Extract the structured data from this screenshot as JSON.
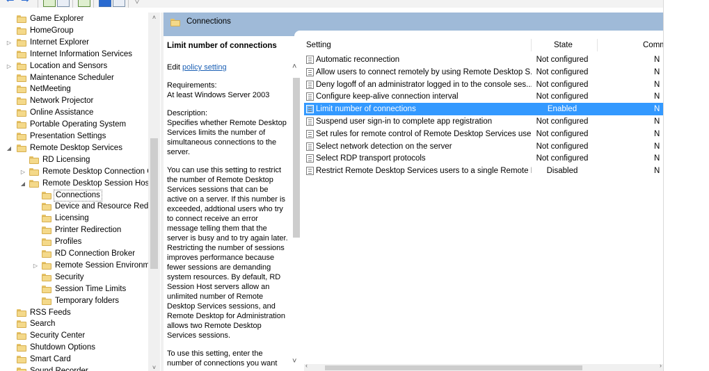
{
  "header": {
    "folder_title": "Connections"
  },
  "tree": {
    "items": [
      {
        "label": "Game Explorer",
        "level": 0,
        "expander": ""
      },
      {
        "label": "HomeGroup",
        "level": 0,
        "expander": ""
      },
      {
        "label": "Internet Explorer",
        "level": 0,
        "expander": "collapsed"
      },
      {
        "label": "Internet Information Services",
        "level": 0,
        "expander": ""
      },
      {
        "label": "Location and Sensors",
        "level": 0,
        "expander": "collapsed"
      },
      {
        "label": "Maintenance Scheduler",
        "level": 0,
        "expander": ""
      },
      {
        "label": "NetMeeting",
        "level": 0,
        "expander": ""
      },
      {
        "label": "Network Projector",
        "level": 0,
        "expander": ""
      },
      {
        "label": "Online Assistance",
        "level": 0,
        "expander": ""
      },
      {
        "label": "Portable Operating System",
        "level": 0,
        "expander": ""
      },
      {
        "label": "Presentation Settings",
        "level": 0,
        "expander": ""
      },
      {
        "label": "Remote Desktop Services",
        "level": 0,
        "expander": "expanded"
      },
      {
        "label": "RD Licensing",
        "level": 1,
        "expander": ""
      },
      {
        "label": "Remote Desktop Connection C",
        "level": 1,
        "expander": "collapsed"
      },
      {
        "label": "Remote Desktop Session Host",
        "level": 1,
        "expander": "expanded"
      },
      {
        "label": "Connections",
        "level": 2,
        "expander": "",
        "selected": true
      },
      {
        "label": "Device and Resource Redire",
        "level": 2,
        "expander": ""
      },
      {
        "label": "Licensing",
        "level": 2,
        "expander": ""
      },
      {
        "label": "Printer Redirection",
        "level": 2,
        "expander": ""
      },
      {
        "label": "Profiles",
        "level": 2,
        "expander": ""
      },
      {
        "label": "RD Connection Broker",
        "level": 2,
        "expander": ""
      },
      {
        "label": "Remote Session Environme",
        "level": 2,
        "expander": "collapsed"
      },
      {
        "label": "Security",
        "level": 2,
        "expander": ""
      },
      {
        "label": "Session Time Limits",
        "level": 2,
        "expander": ""
      },
      {
        "label": "Temporary folders",
        "level": 2,
        "expander": ""
      },
      {
        "label": "RSS Feeds",
        "level": 0,
        "expander": ""
      },
      {
        "label": "Search",
        "level": 0,
        "expander": ""
      },
      {
        "label": "Security Center",
        "level": 0,
        "expander": ""
      },
      {
        "label": "Shutdown Options",
        "level": 0,
        "expander": ""
      },
      {
        "label": "Smart Card",
        "level": 0,
        "expander": ""
      },
      {
        "label": "Sound Recorder",
        "level": 0,
        "expander": ""
      }
    ]
  },
  "description": {
    "title": "Limit number of connections",
    "edit_prefix": "Edit ",
    "edit_link": "policy setting",
    "requirements_label": "Requirements:",
    "requirements_value": "At least Windows Server 2003",
    "description_label": "Description:",
    "paragraph1": "Specifies whether Remote Desktop Services limits the number of simultaneous connections to the server.",
    "paragraph2": "You can use this setting to restrict the number of Remote Desktop Services sessions that can be active on a server. If this number is exceeded, addtional users who try to connect receive an error message telling them that the server is busy and to try again later. Restricting the number of sessions improves performance because fewer sessions are demanding system resources. By default, RD Session Host servers allow an unlimited number of Remote Desktop Services sessions, and Remote Desktop for Administration allows two Remote Desktop Services sessions.",
    "paragraph3": "To use this setting, enter the number of connections you want"
  },
  "table": {
    "columns": {
      "setting": "Setting",
      "state": "State",
      "comment": "Comm"
    },
    "rows": [
      {
        "name": "Automatic reconnection",
        "state": "Not configured",
        "comment": "N"
      },
      {
        "name": "Allow users to connect remotely by using Remote Desktop S...",
        "state": "Not configured",
        "comment": "N"
      },
      {
        "name": "Deny logoff of an administrator logged in to the console ses...",
        "state": "Not configured",
        "comment": "N"
      },
      {
        "name": "Configure keep-alive connection interval",
        "state": "Not configured",
        "comment": "N"
      },
      {
        "name": "Limit number of connections",
        "state": "Enabled",
        "comment": "N",
        "selected": true
      },
      {
        "name": "Suspend user sign-in to complete app registration",
        "state": "Not configured",
        "comment": "N"
      },
      {
        "name": "Set rules for remote control of Remote Desktop Services use...",
        "state": "Not configured",
        "comment": "N"
      },
      {
        "name": "Select network detection on the server",
        "state": "Not configured",
        "comment": "N"
      },
      {
        "name": "Select RDP transport protocols",
        "state": "Not configured",
        "comment": "N"
      },
      {
        "name": "Restrict Remote Desktop Services users to a single Remote D...",
        "state": "Disabled",
        "comment": "N"
      }
    ]
  }
}
